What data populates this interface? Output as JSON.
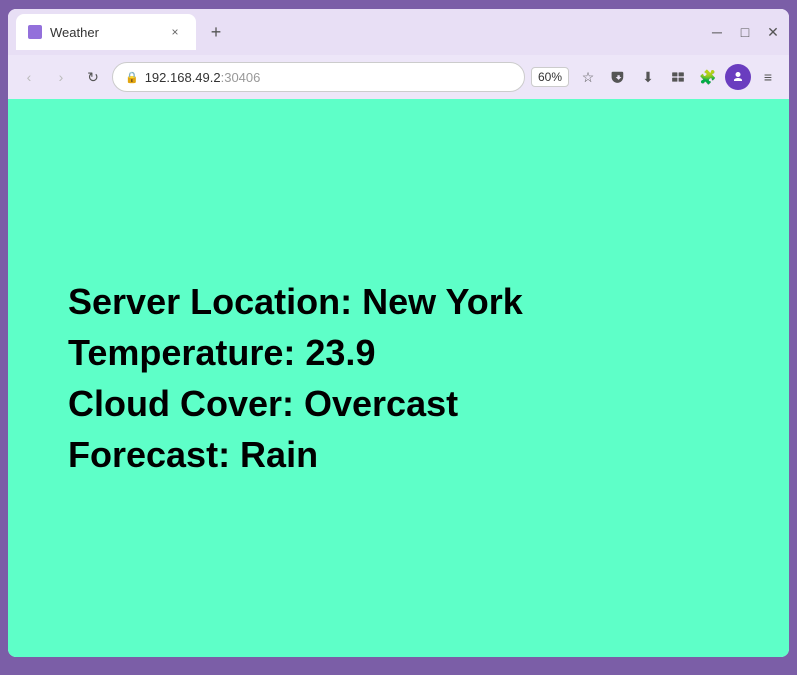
{
  "browser": {
    "tab": {
      "title": "Weather",
      "close_label": "×"
    },
    "new_tab_label": "+",
    "window_controls": {
      "minimize": "─",
      "maximize": "□",
      "close": "✕"
    },
    "address_bar": {
      "url_main": "192.168.49.2",
      "url_port": ":30406",
      "zoom": "60%",
      "nav": {
        "back": "‹",
        "forward": "›",
        "reload": "↻"
      }
    }
  },
  "weather": {
    "location_label": "Server Location:",
    "location_value": "New York",
    "temperature_label": "Temperature:",
    "temperature_value": "23.9",
    "cloud_label": "Cloud Cover:",
    "cloud_value": "Overcast",
    "forecast_label": "Forecast:",
    "forecast_value": "Rain",
    "line1": "Server Location: New York",
    "line2": "Temperature: 23.9",
    "line3": "Cloud Cover: Overcast",
    "line4": "Forecast: Rain"
  }
}
